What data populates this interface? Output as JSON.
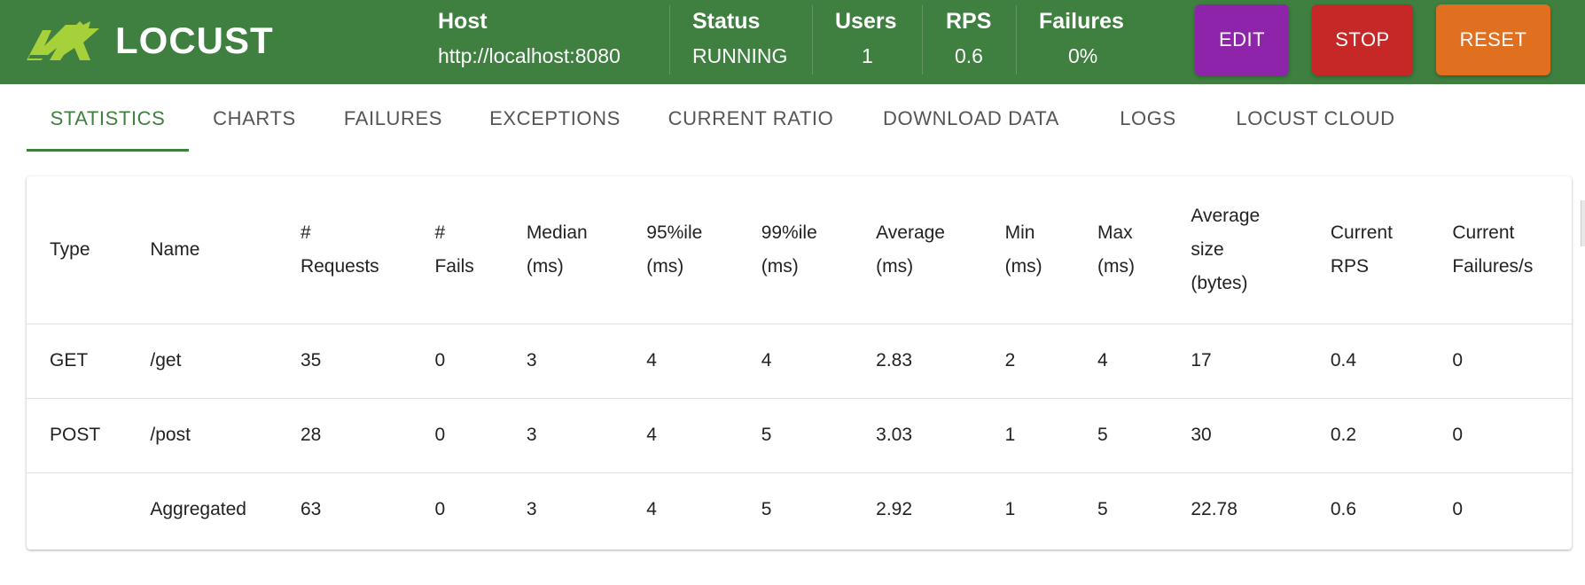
{
  "app": {
    "logo_text": "LOCUST",
    "brand_color": "#3f7f40"
  },
  "stats": [
    {
      "label": "Host",
      "value": "http://localhost:8080"
    },
    {
      "label": "Status",
      "value": "RUNNING"
    },
    {
      "label": "Users",
      "value": "1"
    },
    {
      "label": "RPS",
      "value": "0.6"
    },
    {
      "label": "Failures",
      "value": "0%"
    }
  ],
  "buttons": {
    "edit": {
      "label": "EDIT",
      "color": "#8e24aa"
    },
    "stop": {
      "label": "STOP",
      "color": "#c62828"
    },
    "reset": {
      "label": "RESET",
      "color": "#e07020"
    }
  },
  "tabs": [
    "STATISTICS",
    "CHARTS",
    "FAILURES",
    "EXCEPTIONS",
    "CURRENT RATIO",
    "DOWNLOAD DATA",
    "LOGS",
    "LOCUST CLOUD"
  ],
  "active_tab": "STATISTICS",
  "table": {
    "headers": [
      [
        "Type"
      ],
      [
        "Name"
      ],
      [
        "#",
        "Requests"
      ],
      [
        "#",
        "Fails"
      ],
      [
        "Median",
        "(ms)"
      ],
      [
        "95%ile",
        "(ms)"
      ],
      [
        "99%ile",
        "(ms)"
      ],
      [
        "Average",
        "(ms)"
      ],
      [
        "Min",
        "(ms)"
      ],
      [
        "Max",
        "(ms)"
      ],
      [
        "Average",
        "size",
        "(bytes)"
      ],
      [
        "Current",
        "RPS"
      ],
      [
        "Current",
        "Failures/s"
      ]
    ],
    "rows": [
      [
        "GET",
        "/get",
        "35",
        "0",
        "3",
        "4",
        "4",
        "2.83",
        "2",
        "4",
        "17",
        "0.4",
        "0"
      ],
      [
        "POST",
        "/post",
        "28",
        "0",
        "3",
        "4",
        "5",
        "3.03",
        "1",
        "5",
        "30",
        "0.2",
        "0"
      ],
      [
        "",
        "Aggregated",
        "63",
        "0",
        "3",
        "4",
        "5",
        "2.92",
        "1",
        "5",
        "22.78",
        "0.6",
        "0"
      ]
    ]
  }
}
